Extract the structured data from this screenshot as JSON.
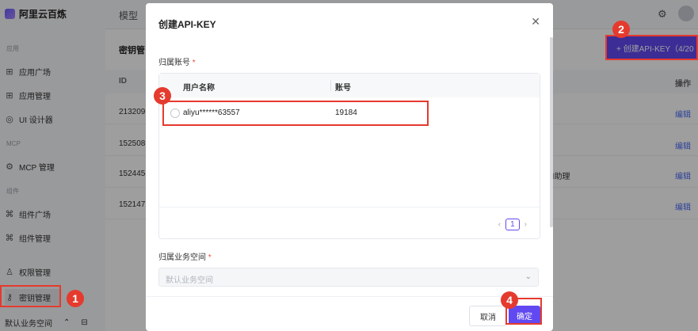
{
  "app": {
    "brand": "阿里云百炼",
    "nav_model": "模型"
  },
  "sidebar": {
    "sections": [
      {
        "label": "应用"
      },
      {
        "label": "MCP"
      },
      {
        "label": "组件"
      }
    ],
    "items": [
      {
        "label": "应用广场",
        "icon": "grid-icon"
      },
      {
        "label": "应用管理",
        "icon": "grid-icon"
      },
      {
        "label": "UI 设计器",
        "icon": "palette-icon"
      },
      {
        "label": "MCP 管理",
        "icon": "mcp-icon"
      },
      {
        "label": "组件广场",
        "icon": "component-icon"
      },
      {
        "label": "组件管理",
        "icon": "component-icon"
      },
      {
        "label": "权限管理",
        "icon": "user-icon"
      },
      {
        "label": "密钥管理",
        "icon": "key-icon"
      }
    ],
    "footer": "默认业务空间"
  },
  "page": {
    "sub_title": "密钥管",
    "create_button": "+ 创建API-KEY（4/20",
    "table_headers": {
      "id": "ID",
      "action": "操作"
    },
    "rows": [
      {
        "id": "213209",
        "action": "编辑",
        "mid": ""
      },
      {
        "id": "152508",
        "action": "编辑",
        "mid": ""
      },
      {
        "id": "152445",
        "action": "编辑",
        "mid": "AI助理"
      },
      {
        "id": "152147",
        "action": "编辑",
        "mid": ""
      }
    ]
  },
  "modal": {
    "title": "创建API-KEY",
    "account_label": "归属账号",
    "required_mark": "*",
    "col_username": "用户名称",
    "col_account": "账号",
    "row_username": "aliyu******63557",
    "row_account": "19184",
    "page_current": "1",
    "workspace_label": "归属业务空间",
    "workspace_placeholder": "默认业务空间",
    "cancel": "取消",
    "confirm": "确定"
  },
  "annotations": [
    "1",
    "2",
    "3",
    "4"
  ],
  "colors": {
    "accent": "#6149f2",
    "annotation": "#e53a2e"
  }
}
